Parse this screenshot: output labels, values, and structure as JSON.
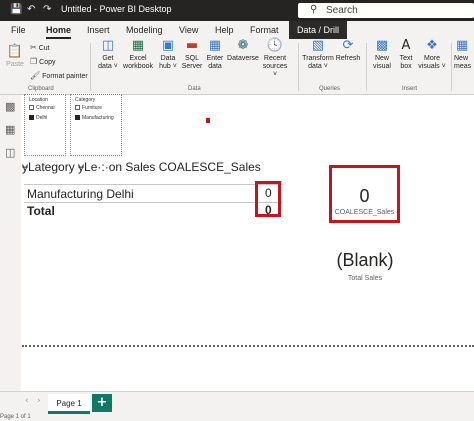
{
  "titlebar": {
    "title": "Untitled - Power BI Desktop",
    "save_icon": "save-icon",
    "undo_icon": "undo-icon",
    "redo_icon": "redo-icon",
    "search_placeholder": "Search"
  },
  "menu": {
    "tabs": [
      "File",
      "Home",
      "Insert",
      "Modeling",
      "View",
      "Help",
      "Format",
      "Data / Drill"
    ]
  },
  "ribbon": {
    "paste": "Paste",
    "cut": "Cut",
    "copy": "Copy",
    "format_painter": "Format painter",
    "clipboard_group": "Clipboard",
    "get_data": [
      "Get",
      "data"
    ],
    "excel_workbook": [
      "Excel",
      "workbook"
    ],
    "data_hub": [
      "Data",
      "hub"
    ],
    "sql_server": [
      "SQL",
      "Server"
    ],
    "enter_data": [
      "Enter",
      "data"
    ],
    "dataverse": "Dataverse",
    "recent_sources": [
      "Recent",
      "sources"
    ],
    "data_group": "Data",
    "transform_data": [
      "Transform",
      "data"
    ],
    "refresh": "Refresh",
    "queries_group": "Queries",
    "new_visual": [
      "New",
      "visual"
    ],
    "text_box": [
      "Text",
      "box"
    ],
    "more_visuals": [
      "More",
      "visuals"
    ],
    "insert_group": "Insert",
    "new_measure": [
      "New",
      "meas"
    ]
  },
  "slicers": {
    "location": {
      "header": "Location",
      "items": [
        {
          "label": "Chennai",
          "checked": false
        },
        {
          "label": "Delhi",
          "checked": true
        }
      ]
    },
    "category": {
      "header": "Category",
      "items": [
        {
          "label": "Furniture",
          "checked": false
        },
        {
          "label": "Manufacturing",
          "checked": true
        }
      ]
    }
  },
  "table": {
    "header_overlap": "ɏLategory   ɏLe·:·on Sales COALESCE_Sales",
    "rows": [
      {
        "label": "Manufacturing Delhi",
        "value": "0"
      }
    ],
    "total": {
      "label": "Total",
      "value": "0"
    }
  },
  "cards": {
    "coalesce": {
      "value": "0",
      "label": "COALESCE_Sales"
    },
    "total_sales": {
      "value": "(Blank)",
      "label": "Total Sales"
    }
  },
  "pages": {
    "tab": "Page 1",
    "add": "+"
  },
  "status": {
    "page_count": "Page 1 of 1"
  },
  "colors": {
    "highlight": "#c5141d",
    "accent": "#117865",
    "titlebar": "#252423"
  }
}
